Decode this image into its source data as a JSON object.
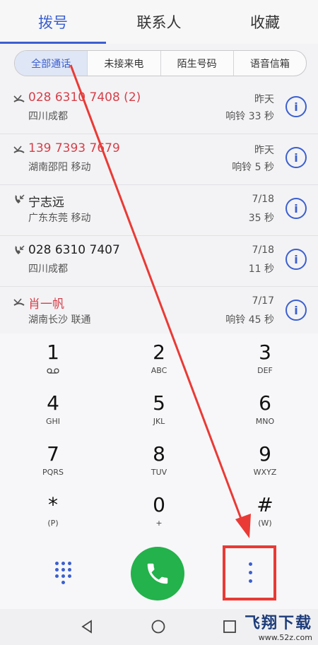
{
  "tabs": [
    {
      "label": "拨号",
      "active": true
    },
    {
      "label": "联系人",
      "active": false
    },
    {
      "label": "收藏",
      "active": false
    }
  ],
  "filters": [
    {
      "label": "全部通话",
      "active": true
    },
    {
      "label": "未接来电",
      "active": false
    },
    {
      "label": "陌生号码",
      "active": false
    },
    {
      "label": "语音信箱",
      "active": false
    }
  ],
  "calls": [
    {
      "name": "028 6310 7408 (2)",
      "location": "四川成都",
      "date": "昨天",
      "duration": "响铃 33 秒",
      "type": "missed-call-icon",
      "missed": true
    },
    {
      "name": "139 7393 7679",
      "location": "湖南邵阳 移动",
      "date": "昨天",
      "duration": "响铃 5 秒",
      "type": "missed-call-icon",
      "missed": true
    },
    {
      "name": "宁志远",
      "location": "广东东莞 移动",
      "date": "7/18",
      "duration": "35 秒",
      "type": "incoming-call-icon",
      "missed": false
    },
    {
      "name": "028 6310 7407",
      "location": "四川成都",
      "date": "7/18",
      "duration": "11 秒",
      "type": "incoming-call-icon",
      "missed": false
    },
    {
      "name": "肖一帆",
      "location": "湖南长沙 联通",
      "date": "7/17",
      "duration": "响铃 45 秒",
      "type": "missed-call-icon",
      "missed": true
    }
  ],
  "keypad": [
    {
      "digit": "1",
      "letters": "voicemail-icon"
    },
    {
      "digit": "2",
      "letters": "ABC"
    },
    {
      "digit": "3",
      "letters": "DEF"
    },
    {
      "digit": "4",
      "letters": "GHI"
    },
    {
      "digit": "5",
      "letters": "JKL"
    },
    {
      "digit": "6",
      "letters": "MNO"
    },
    {
      "digit": "7",
      "letters": "PQRS"
    },
    {
      "digit": "8",
      "letters": "TUV"
    },
    {
      "digit": "9",
      "letters": "WXYZ"
    },
    {
      "digit": "*",
      "letters": "(P)"
    },
    {
      "digit": "0",
      "letters": "+"
    },
    {
      "digit": "#",
      "letters": "(W)"
    }
  ],
  "watermark": {
    "main": "飞翔下载",
    "sub": "www.52z.com"
  },
  "colors": {
    "accent": "#3b5fd0",
    "missed": "#d6404a",
    "call": "#23b24b",
    "annotation": "#ea3a35"
  }
}
